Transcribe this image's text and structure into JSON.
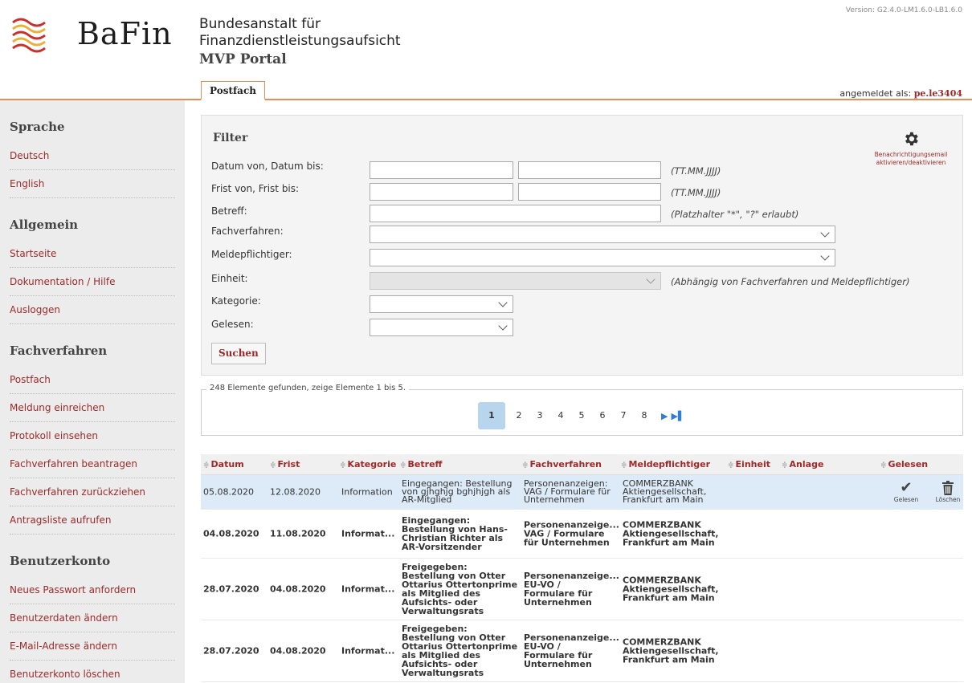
{
  "header": {
    "logo_text": "BaFin",
    "org_line1": "Bundesanstalt für",
    "org_line2": "Finanzdienstleistungsaufsicht",
    "portal": "MVP Portal",
    "version": "Version: G2.4.0-LM1.6.0-LB1.6.0",
    "tab": "Postfach",
    "login_label": "angemeldet als:",
    "login_user": "pe.le3404"
  },
  "sidebar": {
    "sections": [
      {
        "title": "Sprache",
        "items": [
          "Deutsch",
          "English"
        ]
      },
      {
        "title": "Allgemein",
        "items": [
          "Startseite",
          "Dokumentation / Hilfe",
          "Ausloggen"
        ]
      },
      {
        "title": "Fachverfahren",
        "items": [
          "Postfach",
          "Meldung einreichen",
          "Protokoll einsehen",
          "Fachverfahren beantragen",
          "Fachverfahren zurückziehen",
          "Antragsliste aufrufen"
        ]
      },
      {
        "title": "Benutzerkonto",
        "items": [
          "Neues Passwort anfordern",
          "Benutzerdaten ändern",
          "E-Mail-Adresse ändern",
          "Benutzerkonto löschen"
        ]
      }
    ]
  },
  "filter": {
    "title": "Filter",
    "labels": {
      "datum": "Datum von, Datum bis:",
      "frist": "Frist von, Frist bis:",
      "betreff": "Betreff:",
      "fachverfahren": "Fachverfahren:",
      "meldepflichtiger": "Meldepflichtiger:",
      "einheit": "Einheit:",
      "kategorie": "Kategorie:",
      "gelesen": "Gelesen:"
    },
    "hints": {
      "datum": "(TT.MM.JJJJ)",
      "frist": "(TT.MM.JJJJ)",
      "betreff": "(Platzhalter \"*\", \"?\" erlaubt)",
      "einheit": "(Abhängig von Fachverfahren und Meldepflichtiger)"
    },
    "search_button": "Suchen",
    "notification_line1": "Benachrichtigungsemail",
    "notification_line2": "aktivieren/deaktivieren"
  },
  "pagination": {
    "summary": "248 Elemente gefunden, zeige Elemente 1 bis 5.",
    "pages": [
      "1",
      "2",
      "3",
      "4",
      "5",
      "6",
      "7",
      "8"
    ],
    "current": "1",
    "next": "▶",
    "last": "▶▌"
  },
  "table": {
    "headers": [
      "Datum",
      "Frist",
      "Kategorie",
      "Betreff",
      "Fachverfahren",
      "Meldepflichtiger",
      "Einheit",
      "Anlage",
      "Gelesen"
    ],
    "rows": [
      {
        "datum": "05.08.2020",
        "frist": "12.08.2020",
        "kategorie": "Information",
        "betreff": [
          "Eingegangen: Bestellung",
          "von gjhghjg bghjhjgh als",
          "AR-Mitglied"
        ],
        "fachverfahren": [
          "Personenanzeigen:",
          "VAG / Formulare für",
          "Unternehmen"
        ],
        "meldepflichtiger": [
          "COMMERZBANK",
          "Aktiengesellschaft,",
          "Frankfurt am Main"
        ],
        "read_label": "Gelesen",
        "delete_label": "Löschen"
      },
      {
        "datum": "04.08.2020",
        "frist": "11.08.2020",
        "kategorie": "Informat...",
        "betreff": [
          "Eingegangen:",
          "Bestellung von Hans-",
          "Christian Richter als",
          "AR-Vorsitzender"
        ],
        "fachverfahren": [
          "Personenanzeige...",
          "VAG / Formulare",
          "für Unternehmen"
        ],
        "meldepflichtiger": [
          "COMMERZBANK",
          "Aktiengesellschaft,",
          "Frankfurt am Main"
        ]
      },
      {
        "datum": "28.07.2020",
        "frist": "04.08.2020",
        "kategorie": "Informat...",
        "betreff": [
          "Freigegeben:",
          "Bestellung von Otter",
          "Ottarius Ottertonprime",
          "als Mitglied des",
          "Aufsichts- oder",
          "Verwaltungsrats"
        ],
        "fachverfahren": [
          "Personenanzeige...",
          "EU-VO /",
          "Formulare für",
          "Unternehmen"
        ],
        "meldepflichtiger": [
          "COMMERZBANK",
          "Aktiengesellschaft,",
          "Frankfurt am Main"
        ]
      },
      {
        "datum": "28.07.2020",
        "frist": "04.08.2020",
        "kategorie": "Informat...",
        "betreff": [
          "Freigegeben:",
          "Bestellung von Otter",
          "Ottarius Ottertonprime",
          "als Mitglied des",
          "Aufsichts- oder",
          "Verwaltungsrats"
        ],
        "fachverfahren": [
          "Personenanzeige...",
          "EU-VO /",
          "Formulare für",
          "Unternehmen"
        ],
        "meldepflichtiger": [
          "COMMERZBANK",
          "Aktiengesellschaft,",
          "Frankfurt am Main"
        ]
      }
    ]
  },
  "colors": {
    "accent": "#9c2a2a",
    "tab_border": "#e88c55",
    "selected_row": "#ddebf8",
    "pager_active": "#b8d5ee"
  }
}
